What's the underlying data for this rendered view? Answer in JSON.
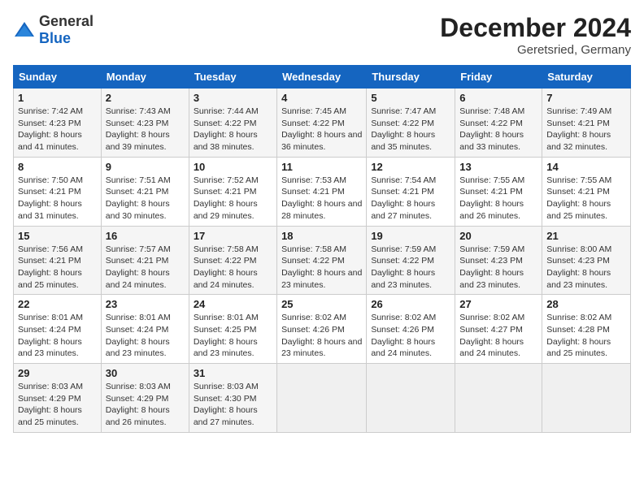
{
  "header": {
    "logo_general": "General",
    "logo_blue": "Blue",
    "month_title": "December 2024",
    "location": "Geretsried, Germany"
  },
  "weekdays": [
    "Sunday",
    "Monday",
    "Tuesday",
    "Wednesday",
    "Thursday",
    "Friday",
    "Saturday"
  ],
  "weeks": [
    [
      {
        "day": "1",
        "sunrise": "7:42 AM",
        "sunset": "4:23 PM",
        "daylight": "8 hours and 41 minutes."
      },
      {
        "day": "2",
        "sunrise": "7:43 AM",
        "sunset": "4:23 PM",
        "daylight": "8 hours and 39 minutes."
      },
      {
        "day": "3",
        "sunrise": "7:44 AM",
        "sunset": "4:22 PM",
        "daylight": "8 hours and 38 minutes."
      },
      {
        "day": "4",
        "sunrise": "7:45 AM",
        "sunset": "4:22 PM",
        "daylight": "8 hours and 36 minutes."
      },
      {
        "day": "5",
        "sunrise": "7:47 AM",
        "sunset": "4:22 PM",
        "daylight": "8 hours and 35 minutes."
      },
      {
        "day": "6",
        "sunrise": "7:48 AM",
        "sunset": "4:22 PM",
        "daylight": "8 hours and 33 minutes."
      },
      {
        "day": "7",
        "sunrise": "7:49 AM",
        "sunset": "4:21 PM",
        "daylight": "8 hours and 32 minutes."
      }
    ],
    [
      {
        "day": "8",
        "sunrise": "7:50 AM",
        "sunset": "4:21 PM",
        "daylight": "8 hours and 31 minutes."
      },
      {
        "day": "9",
        "sunrise": "7:51 AM",
        "sunset": "4:21 PM",
        "daylight": "8 hours and 30 minutes."
      },
      {
        "day": "10",
        "sunrise": "7:52 AM",
        "sunset": "4:21 PM",
        "daylight": "8 hours and 29 minutes."
      },
      {
        "day": "11",
        "sunrise": "7:53 AM",
        "sunset": "4:21 PM",
        "daylight": "8 hours and 28 minutes."
      },
      {
        "day": "12",
        "sunrise": "7:54 AM",
        "sunset": "4:21 PM",
        "daylight": "8 hours and 27 minutes."
      },
      {
        "day": "13",
        "sunrise": "7:55 AM",
        "sunset": "4:21 PM",
        "daylight": "8 hours and 26 minutes."
      },
      {
        "day": "14",
        "sunrise": "7:55 AM",
        "sunset": "4:21 PM",
        "daylight": "8 hours and 25 minutes."
      }
    ],
    [
      {
        "day": "15",
        "sunrise": "7:56 AM",
        "sunset": "4:21 PM",
        "daylight": "8 hours and 25 minutes."
      },
      {
        "day": "16",
        "sunrise": "7:57 AM",
        "sunset": "4:21 PM",
        "daylight": "8 hours and 24 minutes."
      },
      {
        "day": "17",
        "sunrise": "7:58 AM",
        "sunset": "4:22 PM",
        "daylight": "8 hours and 24 minutes."
      },
      {
        "day": "18",
        "sunrise": "7:58 AM",
        "sunset": "4:22 PM",
        "daylight": "8 hours and 23 minutes."
      },
      {
        "day": "19",
        "sunrise": "7:59 AM",
        "sunset": "4:22 PM",
        "daylight": "8 hours and 23 minutes."
      },
      {
        "day": "20",
        "sunrise": "7:59 AM",
        "sunset": "4:23 PM",
        "daylight": "8 hours and 23 minutes."
      },
      {
        "day": "21",
        "sunrise": "8:00 AM",
        "sunset": "4:23 PM",
        "daylight": "8 hours and 23 minutes."
      }
    ],
    [
      {
        "day": "22",
        "sunrise": "8:01 AM",
        "sunset": "4:24 PM",
        "daylight": "8 hours and 23 minutes."
      },
      {
        "day": "23",
        "sunrise": "8:01 AM",
        "sunset": "4:24 PM",
        "daylight": "8 hours and 23 minutes."
      },
      {
        "day": "24",
        "sunrise": "8:01 AM",
        "sunset": "4:25 PM",
        "daylight": "8 hours and 23 minutes."
      },
      {
        "day": "25",
        "sunrise": "8:02 AM",
        "sunset": "4:26 PM",
        "daylight": "8 hours and 23 minutes."
      },
      {
        "day": "26",
        "sunrise": "8:02 AM",
        "sunset": "4:26 PM",
        "daylight": "8 hours and 24 minutes."
      },
      {
        "day": "27",
        "sunrise": "8:02 AM",
        "sunset": "4:27 PM",
        "daylight": "8 hours and 24 minutes."
      },
      {
        "day": "28",
        "sunrise": "8:02 AM",
        "sunset": "4:28 PM",
        "daylight": "8 hours and 25 minutes."
      }
    ],
    [
      {
        "day": "29",
        "sunrise": "8:03 AM",
        "sunset": "4:29 PM",
        "daylight": "8 hours and 25 minutes."
      },
      {
        "day": "30",
        "sunrise": "8:03 AM",
        "sunset": "4:29 PM",
        "daylight": "8 hours and 26 minutes."
      },
      {
        "day": "31",
        "sunrise": "8:03 AM",
        "sunset": "4:30 PM",
        "daylight": "8 hours and 27 minutes."
      },
      null,
      null,
      null,
      null
    ]
  ]
}
